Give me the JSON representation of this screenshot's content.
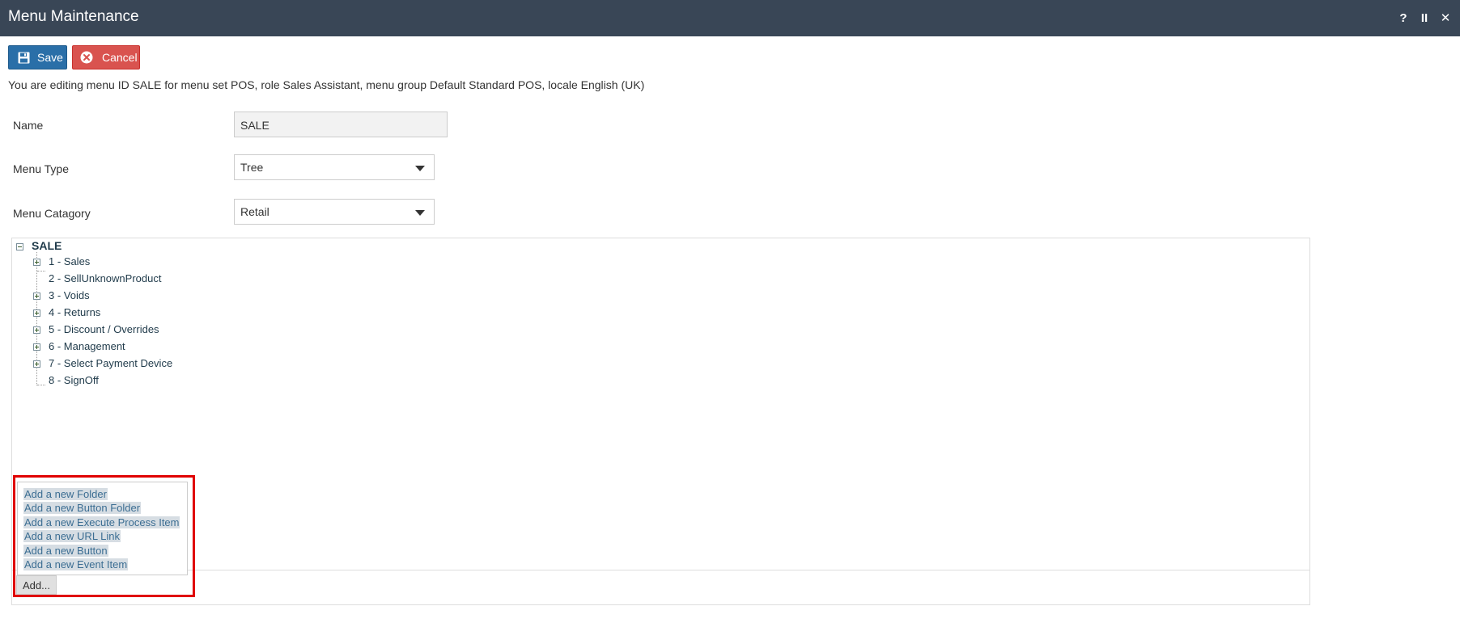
{
  "window": {
    "title": "Menu Maintenance",
    "controls": {
      "help": "?",
      "pause": "II",
      "close": "✕"
    }
  },
  "toolbar": {
    "save_label": "Save",
    "cancel_label": "Cancel",
    "save_icon": "save-icon",
    "cancel_icon": "cancel-icon",
    "save_color": "#2a6fa8",
    "cancel_color": "#d9534f"
  },
  "info_text": "You are editing menu ID SALE for menu set POS, role Sales Assistant, menu group Default Standard POS, locale English (UK)",
  "form": {
    "name": {
      "label": "Name",
      "value": "SALE"
    },
    "menu_type": {
      "label": "Menu Type",
      "value": "Tree"
    },
    "menu_category": {
      "label": "Menu Catagory",
      "value": "Retail"
    }
  },
  "tree": {
    "root": "SALE",
    "items": [
      {
        "label": "1 - Sales",
        "expandable": true
      },
      {
        "label": "2 - SellUnknownProduct",
        "expandable": false
      },
      {
        "label": "3 - Voids",
        "expandable": true
      },
      {
        "label": "4 - Returns",
        "expandable": true
      },
      {
        "label": "5 - Discount / Overrides",
        "expandable": true
      },
      {
        "label": "6 - Management",
        "expandable": true
      },
      {
        "label": "7 - Select Payment Device",
        "expandable": true
      },
      {
        "label": "8 - SignOff",
        "expandable": false
      }
    ]
  },
  "add_menu": {
    "options": [
      "Add a new Folder",
      "Add a new Button Folder",
      "Add a new Execute Process Item",
      "Add a new URL Link",
      "Add a new Button",
      "Add a new Event Item"
    ],
    "button_label": "Add...",
    "highlight_color": "#e00000"
  }
}
